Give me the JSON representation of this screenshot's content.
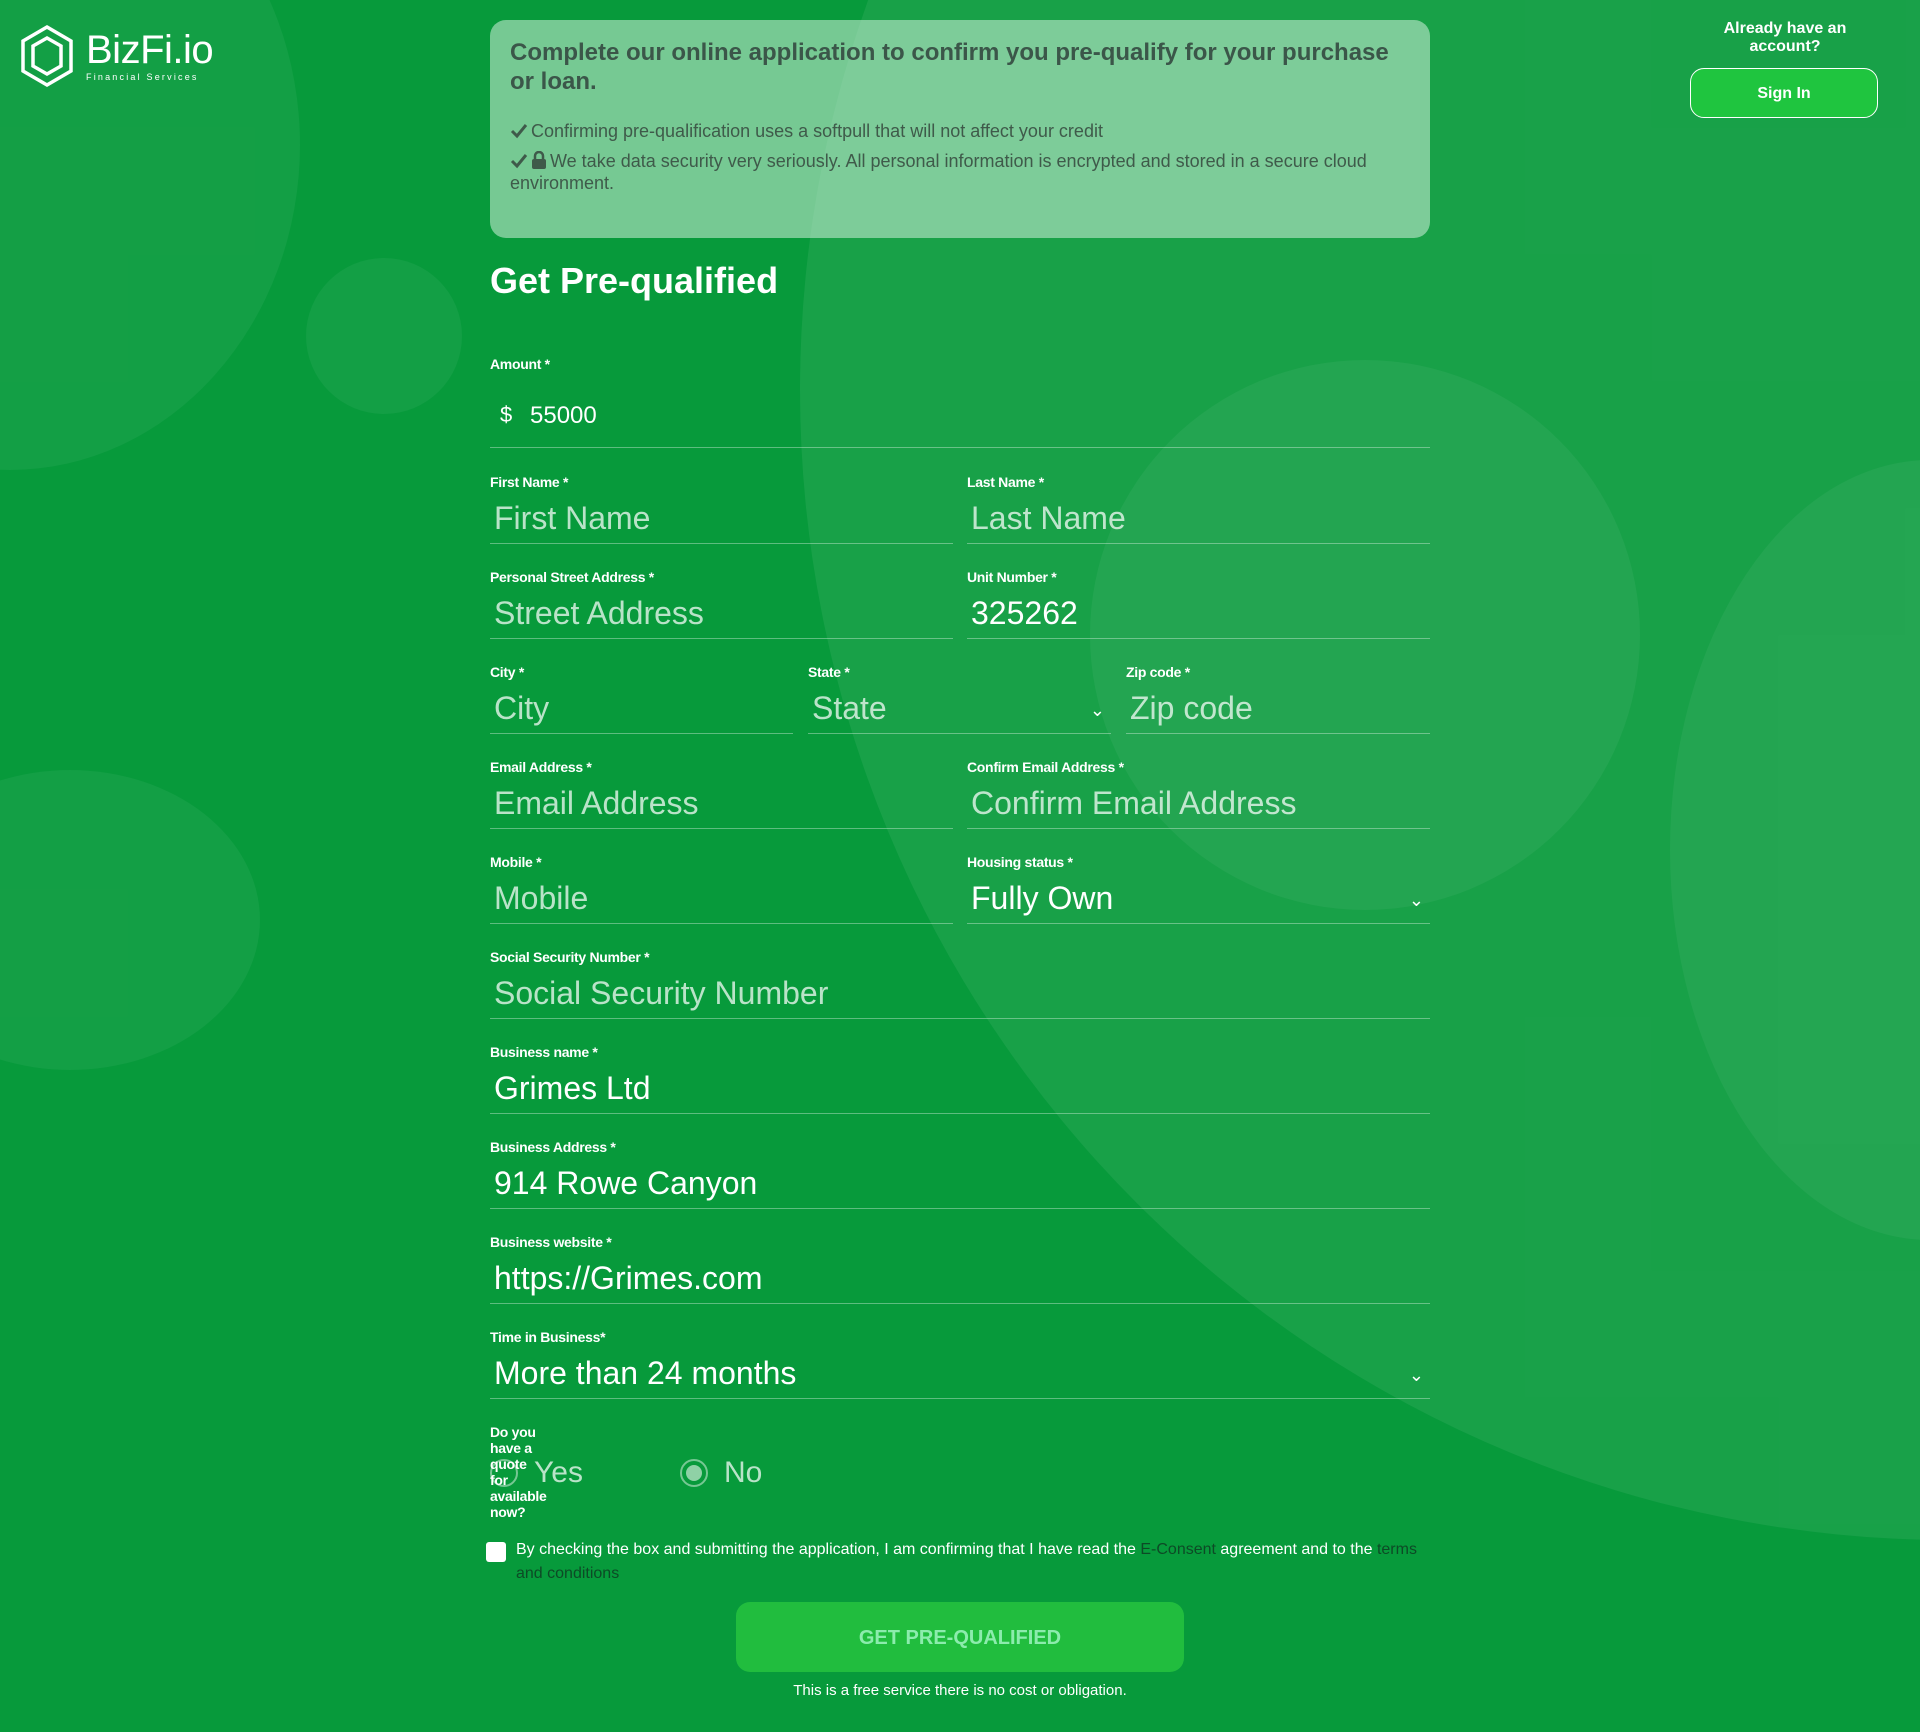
{
  "header": {
    "brand_name": "BizFi.io",
    "brand_tagline": "Financial Services",
    "account_prompt": "Already have an account?",
    "sign_in_label": "Sign In"
  },
  "info_box": {
    "title": "Complete our online application to confirm you pre-qualify for your purchase or loan.",
    "line1": "Confirming pre-qualification uses a softpull that will not affect your credit",
    "line2": "We take data security very seriously. All personal information is encrypted and stored in a secure cloud environment."
  },
  "form": {
    "title": "Get Pre-qualified",
    "currency_symbol": "$",
    "fields": {
      "amount": {
        "label": "Amount *",
        "value": "55000"
      },
      "first_name": {
        "label": "First Name *",
        "placeholder": "First Name",
        "value": ""
      },
      "last_name": {
        "label": "Last Name *",
        "placeholder": "Last Name",
        "value": ""
      },
      "street": {
        "label": "Personal Street Address *",
        "placeholder": "Street Address",
        "value": ""
      },
      "unit": {
        "label": "Unit Number *",
        "value": "325262"
      },
      "city": {
        "label": "City *",
        "placeholder": "City",
        "value": ""
      },
      "state": {
        "label": "State *",
        "placeholder": "State",
        "value": ""
      },
      "zip": {
        "label": "Zip code *",
        "placeholder": "Zip code",
        "value": ""
      },
      "email": {
        "label": "Email Address *",
        "placeholder": "Email Address",
        "value": ""
      },
      "confirm_email": {
        "label": "Confirm Email Address *",
        "placeholder": "Confirm Email Address",
        "value": ""
      },
      "mobile": {
        "label": "Mobile *",
        "placeholder": "Mobile",
        "value": ""
      },
      "housing": {
        "label": "Housing status *",
        "value": "Fully Own"
      },
      "ssn": {
        "label": "Social Security Number *",
        "placeholder": "Social Security Number",
        "value": ""
      },
      "business_name": {
        "label": "Business name *",
        "value": "Grimes Ltd"
      },
      "business_address": {
        "label": "Business Address *",
        "value": "914 Rowe Canyon"
      },
      "business_website": {
        "label": "Business website *",
        "value": "https://Grimes.com"
      },
      "time_in_business": {
        "label": "Time in Business*",
        "value": "More than 24 months"
      }
    },
    "quote": {
      "question": "Do you have a quote for available now?",
      "options": [
        "Yes",
        "No"
      ],
      "selected": "No"
    },
    "consent": {
      "text_before": "By checking the box and submitting the application, I am confirming that I have read the ",
      "link1": "E-Consent",
      "text_middle": " agreement and to the ",
      "link2": "terms and conditions"
    },
    "submit_label": "GET PRE-QUALIFIED",
    "footnote": "This is a free service there is no cost or obligation."
  }
}
